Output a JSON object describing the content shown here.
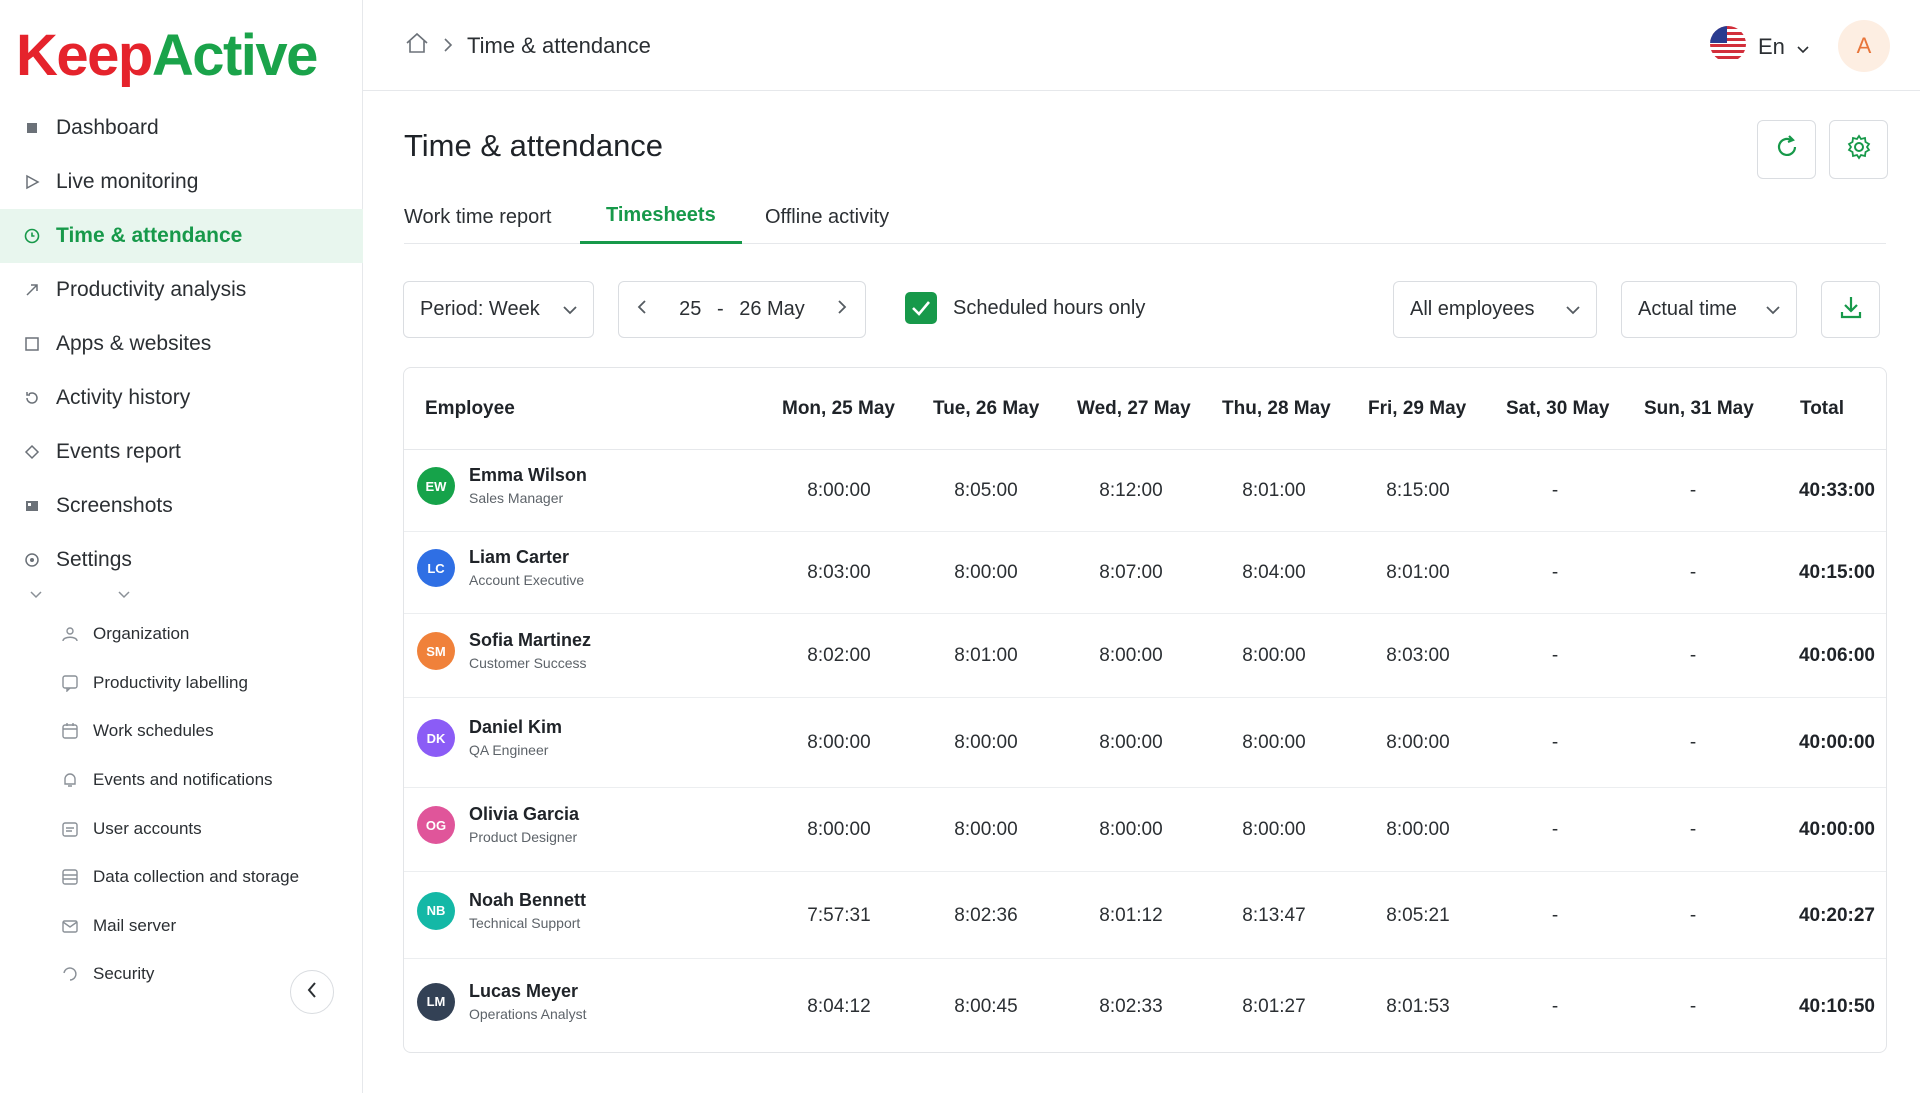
{
  "brand": {
    "part1": "Keep",
    "part2": "Active"
  },
  "sidebar": {
    "items": [
      {
        "label": "Dashboard",
        "icon": "grid-icon"
      },
      {
        "label": "Live monitoring",
        "icon": "play-icon"
      },
      {
        "label": "Time & attendance",
        "icon": "clock-icon",
        "active": true
      },
      {
        "label": "Productivity analysis",
        "icon": "trend-icon"
      },
      {
        "label": "Apps & websites",
        "icon": "square-icon"
      },
      {
        "label": "Activity history",
        "icon": "history-icon"
      },
      {
        "label": "Events report",
        "icon": "diamond-icon"
      },
      {
        "label": "Screenshots",
        "icon": "image-icon"
      },
      {
        "label": "Settings",
        "icon": "gear-icon"
      }
    ],
    "settings_sub": [
      {
        "label": "Organization",
        "icon": "org-icon"
      },
      {
        "label": "Productivity labelling",
        "icon": "label-icon"
      },
      {
        "label": "Work schedules",
        "icon": "calendar-icon"
      },
      {
        "label": "Events and notifications",
        "icon": "bell-icon"
      },
      {
        "label": "User accounts",
        "icon": "users-icon"
      },
      {
        "label": "Data collection and storage",
        "icon": "database-icon"
      },
      {
        "label": "Mail server",
        "icon": "mail-icon"
      },
      {
        "label": "Security",
        "icon": "shield-icon"
      }
    ]
  },
  "header": {
    "breadcrumb": "Time & attendance",
    "language": "En",
    "user_initial": "A"
  },
  "page": {
    "title": "Time & attendance",
    "tabs": [
      "Work time report",
      "Timesheets",
      "Offline activity"
    ],
    "active_tab": "Timesheets"
  },
  "filters": {
    "period": "Period: Week",
    "range_start": "25",
    "range_sep": "-",
    "range_end": "26 May",
    "scheduled_only_label": "Scheduled hours only",
    "scheduled_only_checked": true,
    "employees": "All employees",
    "time_mode": "Actual time"
  },
  "table": {
    "headers": [
      "Employee",
      "Mon, 25 May",
      "Tue, 26 May",
      "Wed, 27 May",
      "Thu, 28 May",
      "Fri, 29 May",
      "Sat, 30 May",
      "Sun, 31 May",
      "Total"
    ],
    "rows": [
      {
        "initials": "EW",
        "color": "#16a34a",
        "name": "Emma Wilson",
        "role": "Sales Manager",
        "days": [
          "8:00:00",
          "8:05:00",
          "8:12:00",
          "8:01:00",
          "8:15:00",
          "-",
          "-"
        ],
        "total": "40:33:00"
      },
      {
        "initials": "LC",
        "color": "#2f6fe4",
        "name": "Liam Carter",
        "role": "Account Executive",
        "days": [
          "8:03:00",
          "8:00:00",
          "8:07:00",
          "8:04:00",
          "8:01:00",
          "-",
          "-"
        ],
        "total": "40:15:00"
      },
      {
        "initials": "SM",
        "color": "#f0813a",
        "name": "Sofia Martinez",
        "role": "Customer Success",
        "days": [
          "8:02:00",
          "8:01:00",
          "8:00:00",
          "8:00:00",
          "8:03:00",
          "-",
          "-"
        ],
        "total": "40:06:00"
      },
      {
        "initials": "DK",
        "color": "#8b5cf6",
        "name": "Daniel Kim",
        "role": "QA Engineer",
        "days": [
          "8:00:00",
          "8:00:00",
          "8:00:00",
          "8:00:00",
          "8:00:00",
          "-",
          "-"
        ],
        "total": "40:00:00"
      },
      {
        "initials": "OG",
        "color": "#e0559a",
        "name": "Olivia Garcia",
        "role": "Product Designer",
        "days": [
          "8:00:00",
          "8:00:00",
          "8:00:00",
          "8:00:00",
          "8:00:00",
          "-",
          "-"
        ],
        "total": "40:00:00"
      },
      {
        "initials": "NB",
        "color": "#14b8a6",
        "name": "Noah Bennett",
        "role": "Technical Support",
        "days": [
          "7:57:31",
          "8:02:36",
          "8:01:12",
          "8:13:47",
          "8:05:21",
          "-",
          "-"
        ],
        "total": "40:20:27"
      },
      {
        "initials": "LM",
        "color": "#334155",
        "name": "Lucas Meyer",
        "role": "Operations Analyst",
        "days": [
          "8:04:12",
          "8:00:45",
          "8:02:33",
          "8:01:27",
          "8:01:53",
          "-",
          "-"
        ],
        "total": "40:10:50"
      }
    ]
  },
  "colors": {
    "accent": "#17994a",
    "brand_red": "#e5232c",
    "brand_green": "#1aa34a"
  }
}
